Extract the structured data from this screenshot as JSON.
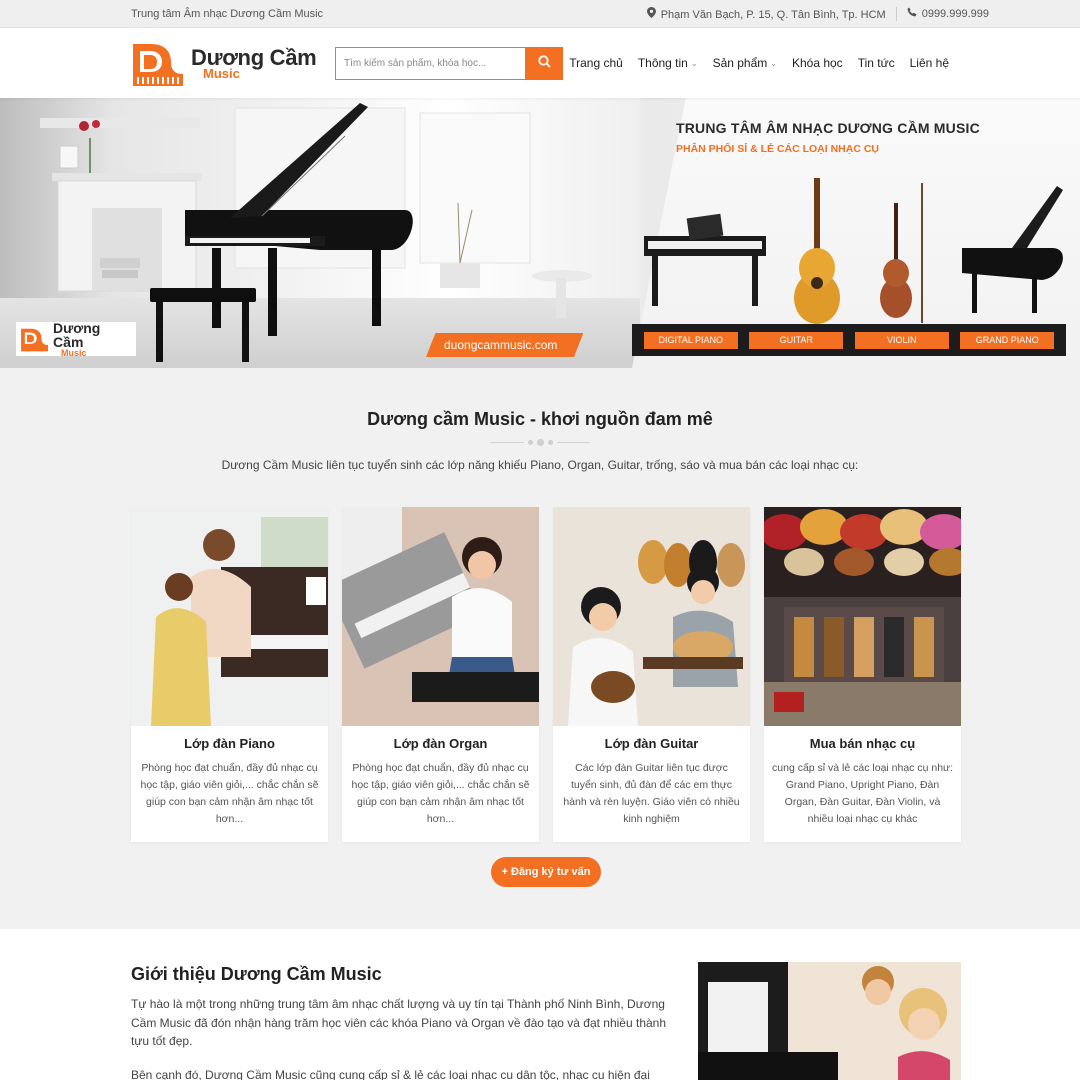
{
  "topbar": {
    "left_text": "Trung tâm Âm nhạc Dương Cầm Music",
    "address": "Phạm Văn Bạch, P. 15, Q. Tân Bình, Tp. HCM",
    "phone": "0999.999.999"
  },
  "header": {
    "logo_line1": "Dương Cầm",
    "logo_line2": "Music",
    "search_placeholder": "Tìm kiếm sản phẩm, khóa học...",
    "nav": [
      {
        "label": "Trang chủ",
        "has_caret": false
      },
      {
        "label": "Thông tin",
        "has_caret": true
      },
      {
        "label": "Sản phẩm",
        "has_caret": true
      },
      {
        "label": "Khóa học",
        "has_caret": false
      },
      {
        "label": "Tin tức",
        "has_caret": false
      },
      {
        "label": "Liên hệ",
        "has_caret": false
      }
    ]
  },
  "hero": {
    "title": "TRUNG TÂM ÂM NHẠC DƯƠNG CẦM MUSIC",
    "subtitle": "PHÂN PHỐI SỈ & LẺ CÁC LOẠI NHẠC CỤ",
    "tags": [
      "DIGITAL PIANO",
      "GUITAR",
      "VIOLIN",
      "GRAND PIANO"
    ],
    "url": "duongcammusic.com",
    "logo_line1": "Dương Cầm",
    "logo_line2": "Music"
  },
  "section": {
    "title": "Dương cầm Music - khơi nguồn đam mê",
    "description": "Dương Cầm Music liên tục tuyển sinh các lớp năng khiếu Piano, Organ, Guitar, trống, sáo và mua bán các loại nhạc cụ:",
    "cards": [
      {
        "title": "Lớp đàn Piano",
        "text": "Phòng học đạt chuẩn, đầy đủ nhạc cụ học tập, giáo viên giỏi,... chắc chắn sẽ giúp con bạn cảm nhận âm nhạc tốt hơn..."
      },
      {
        "title": "Lớp đàn Organ",
        "text": "Phòng học đạt chuẩn, đầy đủ nhạc cụ học tập, giáo viên giỏi,... chắc chắn sẽ giúp con bạn cảm nhận âm nhạc tốt hơn..."
      },
      {
        "title": "Lớp đàn Guitar",
        "text": "Các lớp đàn Guitar liên tục được tuyển sinh, đủ đàn để các em thực hành và rèn luyện. Giáo viên có nhiều kinh nghiệm"
      },
      {
        "title": "Mua bán nhạc cụ",
        "text": "cung cấp sỉ và lẻ các loại nhạc cụ như: Grand Piano, Upright Piano, Đàn Organ, Đàn Guitar, Đàn Violin, và nhiều loại nhạc cụ khác"
      }
    ],
    "cta_label": "+ Đăng ký tư vấn"
  },
  "about": {
    "title": "Giới thiệu Dương Cầm Music",
    "p1": "Tự hào là một trong những trung tâm âm nhạc chất lượng và uy tín tại Thành phố Ninh Bình, Dương Cầm Music đã đón nhận hàng trăm học viên các khóa Piano và Organ về đào tạo và đạt nhiều thành tựu tốt đẹp.",
    "p2": "Bên cạnh đó, Dương Cầm Music cũng cung cấp sỉ & lẻ các loại nhạc cụ dân tộc, nhạc cụ hiện đại như:"
  },
  "colors": {
    "accent": "#f36f21",
    "topbar_bg": "#efefef",
    "section_bg": "#f1f1f1"
  }
}
